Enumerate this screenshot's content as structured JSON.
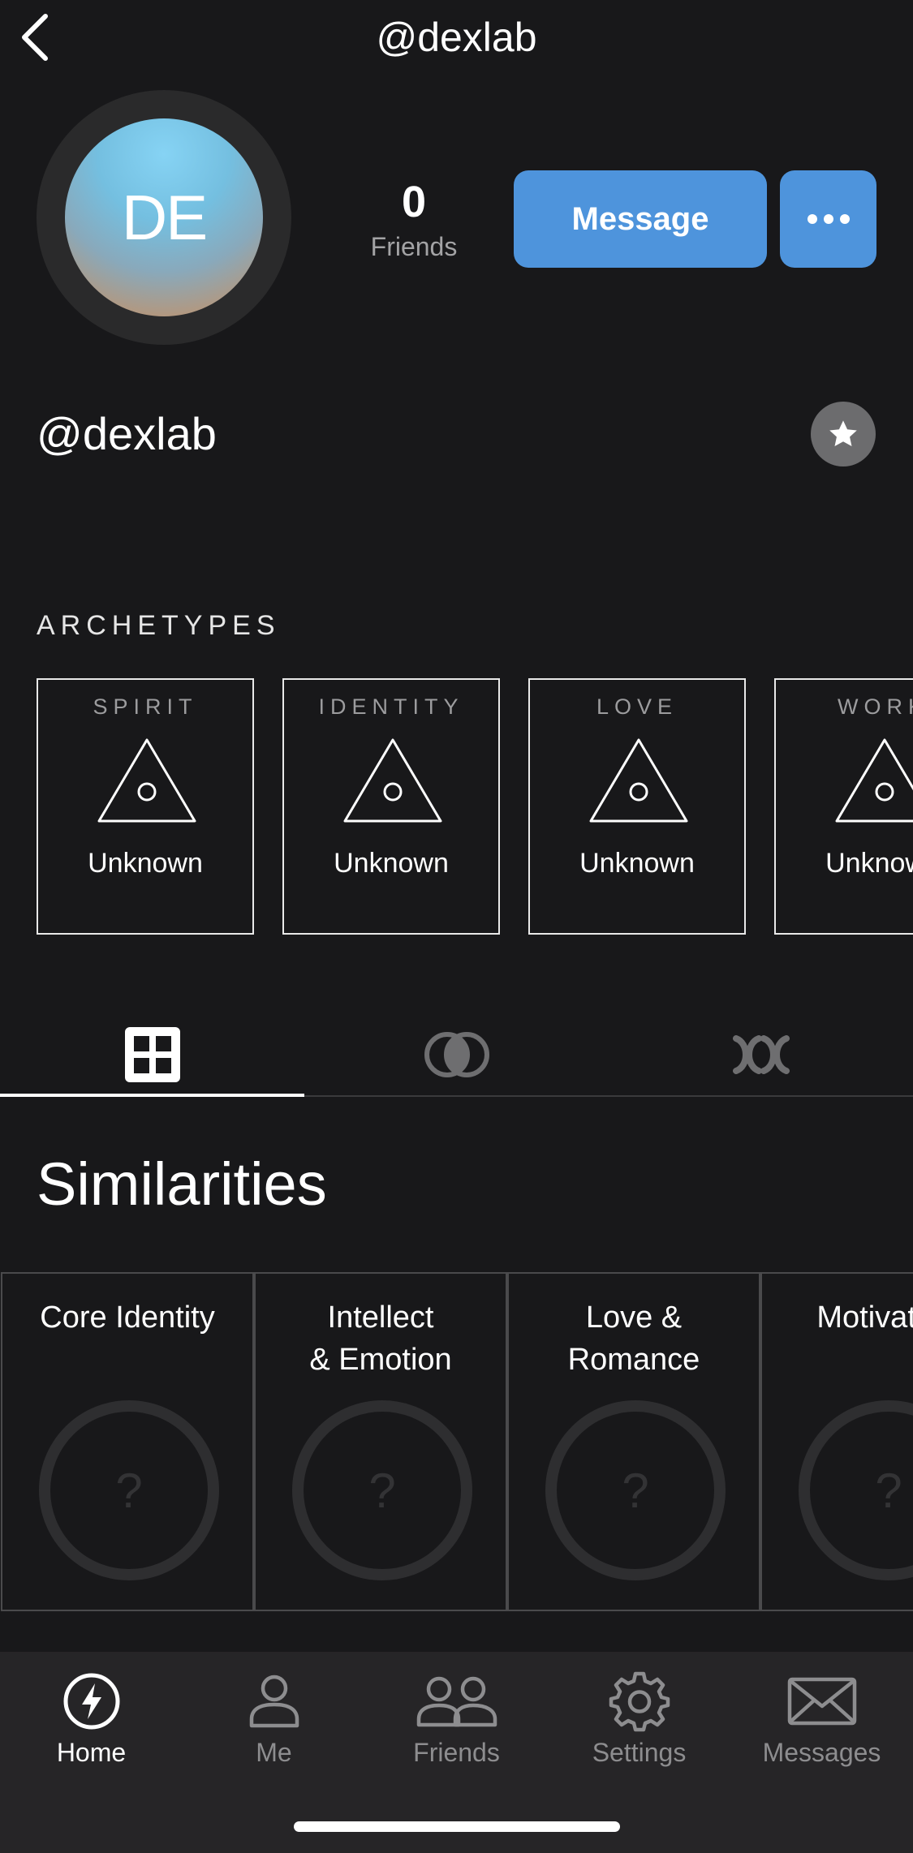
{
  "header": {
    "title": "@dexlab"
  },
  "profile": {
    "initials": "DE",
    "friends_count": "0",
    "friends_label": "Friends",
    "message_label": "Message",
    "username": "@dexlab"
  },
  "archetypes": {
    "title": "ARCHETYPES",
    "cards": [
      {
        "category": "SPIRIT",
        "value": "Unknown"
      },
      {
        "category": "IDENTITY",
        "value": "Unknown"
      },
      {
        "category": "LOVE",
        "value": "Unknown"
      },
      {
        "category": "WORK",
        "value": "Unknown"
      }
    ]
  },
  "tabs": [
    {
      "icon": "grid-icon",
      "active": true
    },
    {
      "icon": "overlap-circles-icon",
      "active": false
    },
    {
      "icon": "chromosome-icon",
      "active": false
    }
  ],
  "similarities": {
    "title": "Similarities",
    "cards": [
      {
        "label": "Core Identity",
        "value": "?"
      },
      {
        "label": "Intellect\n& Emotion",
        "value": "?"
      },
      {
        "label": "Love &\nRomance",
        "value": "?"
      },
      {
        "label": "Motivation",
        "value": "?"
      }
    ]
  },
  "nav": {
    "items": [
      {
        "label": "Home",
        "icon": "lightning-icon",
        "active": true
      },
      {
        "label": "Me",
        "icon": "person-icon",
        "active": false
      },
      {
        "label": "Friends",
        "icon": "friends-icon",
        "active": false
      },
      {
        "label": "Settings",
        "icon": "gear-icon",
        "active": false
      },
      {
        "label": "Messages",
        "icon": "envelope-icon",
        "active": false
      }
    ]
  },
  "colors": {
    "background": "#18181a",
    "accent": "#4e94dc",
    "nav_bg": "#262527"
  }
}
